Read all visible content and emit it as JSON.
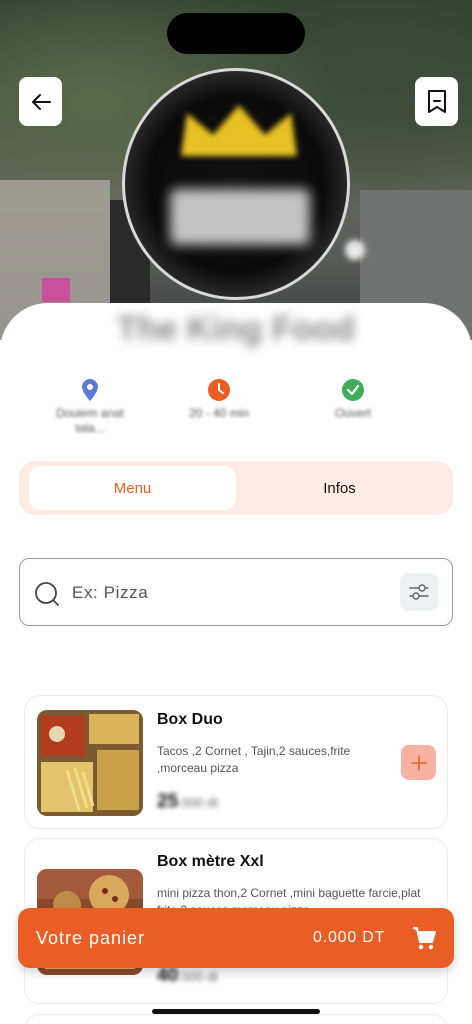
{
  "restaurant": {
    "name": "The King Food"
  },
  "info": {
    "location": {
      "label": "Douiem anat tala...",
      "icon": "location-pin-icon",
      "color": "#5b7ad6"
    },
    "delivery_time": {
      "label": "20 - 40 min",
      "icon": "clock-icon",
      "color": "#ea5e25"
    },
    "status": {
      "label": "Ouvert",
      "icon": "check-circle-icon",
      "color": "#3fae5a"
    }
  },
  "tabs": [
    {
      "label": "Menu",
      "active": true
    },
    {
      "label": "Infos",
      "active": false
    }
  ],
  "search": {
    "placeholder": "Ex: Pizza",
    "value": ""
  },
  "products": [
    {
      "title": "Box Duo",
      "description": "Tacos ,2 Cornet , Tajin,2 sauces,frite ,morceau pizza",
      "price_main": "25",
      "price_suffix": ".000 dt"
    },
    {
      "title": "Box mètre Xxl",
      "description": "mini pizza thon,2 Cornet ,mini baguette farcie,plat frite,2 sauces,morceau pizza",
      "price_main": "40",
      "price_suffix": ".000 dt"
    }
  ],
  "cart": {
    "label": "Votre panier",
    "total": "0.000 DT"
  },
  "colors": {
    "accent": "#ea5e25",
    "tab_bg": "#fdebe4",
    "add_button": "#f7b2a1"
  }
}
